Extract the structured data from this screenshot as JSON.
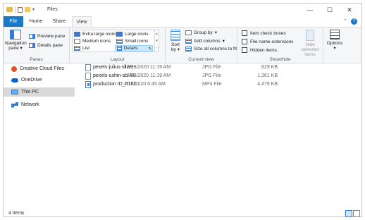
{
  "window": {
    "title": "Files",
    "controls": {
      "minimize": "—",
      "maximize": "☐",
      "close": "✕"
    }
  },
  "tabs": [
    {
      "label": "File"
    },
    {
      "label": "Home"
    },
    {
      "label": "Share"
    },
    {
      "label": "View"
    }
  ],
  "ribbon": {
    "panes": {
      "label": "Panes",
      "navigation_pane": "Navigation pane",
      "preview_pane": "Preview pane",
      "details_pane": "Details pane"
    },
    "layout": {
      "label": "Layout",
      "options": [
        "Extra large icons",
        "Large icons",
        "Medium icons",
        "Small icons",
        "List",
        "Details"
      ],
      "selected": "Details"
    },
    "current_view": {
      "label": "Current view",
      "sort_by": "Sort by",
      "group_by": "Group by",
      "add_columns": "Add columns",
      "size_all_columns": "Size all columns to fit"
    },
    "show_hide": {
      "label": "Show/hide",
      "item_check_boxes": "Item check boxes",
      "file_name_extensions": "File name extensions",
      "hidden_items": "Hidden items",
      "hide_selected_items": "Hide selected items"
    },
    "options": {
      "label": "Options"
    }
  },
  "nav": {
    "items": [
      {
        "label": "Creative Cloud Files",
        "icon": "creative-cloud-icon"
      },
      {
        "label": "OneDrive",
        "icon": "onedrive-icon"
      },
      {
        "label": "This PC",
        "icon": "this-pc-icon",
        "selected": true
      },
      {
        "label": "Network",
        "icon": "network-icon"
      }
    ]
  },
  "files": [
    {
      "name": "pexels-julius-silver-...",
      "date": "12/29/2020 11:19 AM",
      "type": "JPG File",
      "size": "829 KB",
      "icon": "jpg-file-icon"
    },
    {
      "name": "pexels-ushin-so-44...",
      "date": "12/29/2020 11:19 AM",
      "type": "JPG File",
      "size": "1,361 KB",
      "icon": "jpg-file-icon"
    },
    {
      "name": "production ID_4182...",
      "date": "4/18/2020 6:45 AM",
      "type": "MP4 File",
      "size": "4,479 KB",
      "icon": "mp4-file-icon"
    }
  ],
  "status": {
    "item_count": "4 items"
  }
}
